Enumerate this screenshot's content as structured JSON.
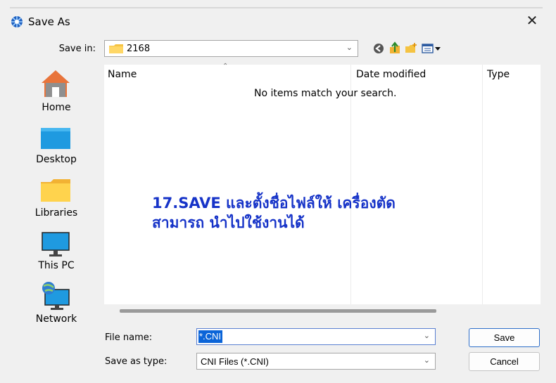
{
  "window": {
    "title": "Save As",
    "close_label": "✕"
  },
  "toolbar": {
    "save_in_label": "Save in:",
    "save_in_value": "2168",
    "icons": [
      "back-icon",
      "up-folder-icon",
      "new-folder-icon",
      "view-menu-icon"
    ]
  },
  "places": [
    {
      "label": "Home",
      "icon": "home-icon"
    },
    {
      "label": "Desktop",
      "icon": "desktop-icon"
    },
    {
      "label": "Libraries",
      "icon": "libraries-icon"
    },
    {
      "label": "This PC",
      "icon": "this-pc-icon"
    },
    {
      "label": "Network",
      "icon": "network-icon"
    }
  ],
  "file_list": {
    "columns": [
      "Name",
      "Date modified",
      "Type"
    ],
    "empty_message": "No items match your search."
  },
  "annotation": {
    "line1": "17.SAVE และตั้งชื่อไฟล์ให้ เครื่องตัด",
    "line2": "สามารถ นำไปใช้งานได้"
  },
  "form": {
    "file_name_label": "File name:",
    "file_name_value": "*.CNI",
    "save_as_type_label": "Save as type:",
    "save_as_type_value": "CNI Files (*.CNI)"
  },
  "buttons": {
    "save": "Save",
    "cancel": "Cancel"
  },
  "colors": {
    "accent": "#0a64d8",
    "annotation_text": "#1633c8",
    "folder": "#f5c342"
  }
}
